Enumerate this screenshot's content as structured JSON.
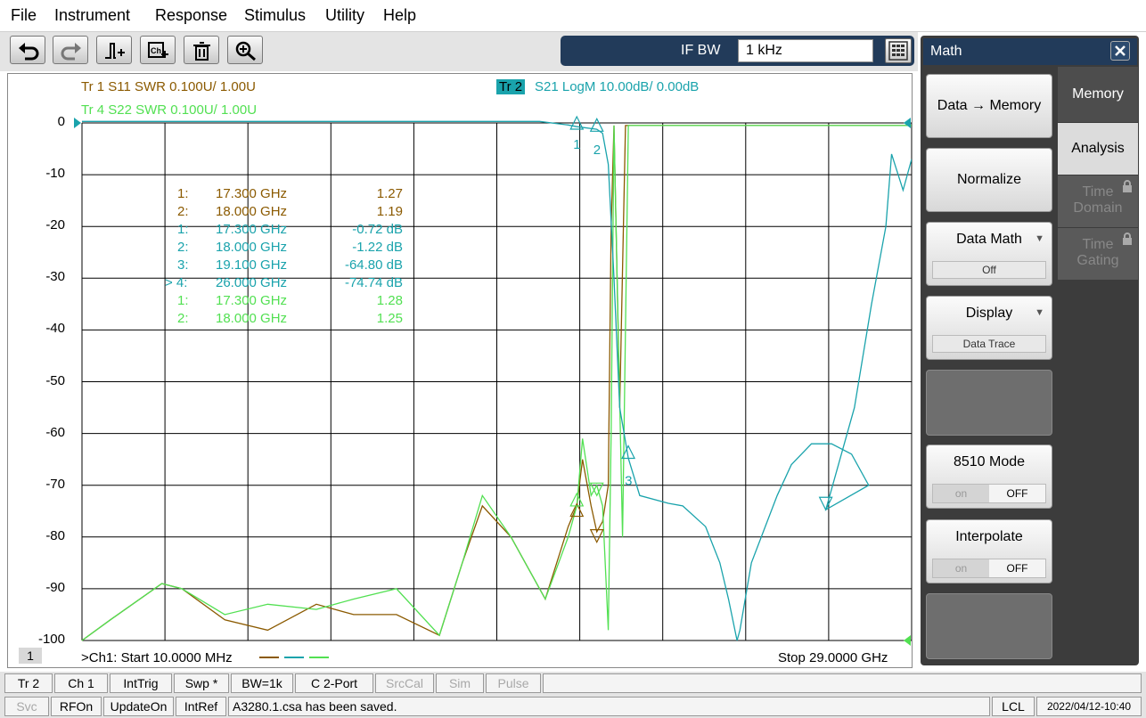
{
  "menu": [
    "File",
    "Instrument",
    "Response",
    "Stimulus",
    "Utility",
    "Help"
  ],
  "toolbar": {
    "undo_icon": "undo-arrow-icon",
    "redo_icon": "redo-arrow-icon",
    "marker_icon": "marker-add-icon",
    "channel_icon": "channel-add-icon",
    "delete_icon": "trash-icon",
    "zoom_icon": "zoom-in-icon"
  },
  "ifbw": {
    "label": "IF BW",
    "value": "1 kHz",
    "keypad_icon": "keypad-icon"
  },
  "traces": {
    "tr1": "Tr  1   S11 SWR 0.100U/  1.00U",
    "tr2_badge": "Tr  2",
    "tr2": "S21 LogM 10.00dB/  0.00dB",
    "tr4": "Tr  4   S22 SWR 0.100U/  1.00U"
  },
  "colors": {
    "tr1": "#8b5a00",
    "tr2": "#1aa3ac",
    "tr4": "#52e052",
    "grid": "#000000"
  },
  "chart_data": {
    "type": "line",
    "x_start": "10.0000 MHz",
    "x_stop": "29.0000 GHz",
    "xlim_ghz": [
      0.01,
      29
    ],
    "ylim": [
      -100,
      0
    ],
    "yticks": [
      "0",
      "-10",
      "-20",
      "-30",
      "-40",
      "-50",
      "-60",
      "-70",
      "-80",
      "-90",
      "-100"
    ],
    "grid": true,
    "series": [
      {
        "name": "S21 LogM",
        "points": [
          [
            0.01,
            0.3
          ],
          [
            8,
            0.3
          ],
          [
            14,
            0.3
          ],
          [
            16,
            0.3
          ],
          [
            17,
            -0.4
          ],
          [
            17.3,
            -0.72
          ],
          [
            18,
            -1.22
          ],
          [
            18.2,
            -2
          ],
          [
            18.4,
            -8
          ],
          [
            18.6,
            -30
          ],
          [
            18.8,
            -55
          ],
          [
            19.1,
            -64.8
          ],
          [
            19.5,
            -72
          ],
          [
            20.5,
            -73.5
          ],
          [
            21,
            -74
          ],
          [
            21.8,
            -78
          ],
          [
            22.3,
            -85
          ],
          [
            22.6,
            -92
          ],
          [
            22.9,
            -100
          ],
          [
            23,
            -98
          ],
          [
            23.4,
            -85
          ],
          [
            24.3,
            -72
          ],
          [
            24.8,
            -66
          ],
          [
            25.5,
            -62
          ],
          [
            26.2,
            -62
          ],
          [
            26.9,
            -64
          ],
          [
            27.5,
            -70
          ],
          [
            26,
            -74.74
          ],
          [
            27,
            -55
          ],
          [
            27.6,
            -35
          ],
          [
            28.1,
            -20
          ],
          [
            28.3,
            -6
          ],
          [
            28.7,
            -13
          ],
          [
            29,
            -7
          ]
        ]
      },
      {
        "name": "S11 SWR",
        "points": [
          [
            0.01,
            -100
          ],
          [
            1,
            -96
          ],
          [
            2.8,
            -89
          ],
          [
            3.5,
            -90
          ],
          [
            5,
            -96
          ],
          [
            6.5,
            -98
          ],
          [
            8.2,
            -93
          ],
          [
            9.5,
            -95
          ],
          [
            11,
            -95
          ],
          [
            12.5,
            -99
          ],
          [
            13.3,
            -85
          ],
          [
            14,
            -74
          ],
          [
            15,
            -80
          ],
          [
            16.2,
            -92
          ],
          [
            17,
            -78
          ],
          [
            17.3,
            -74
          ],
          [
            17.5,
            -65
          ],
          [
            17.8,
            -74
          ],
          [
            18,
            -79
          ],
          [
            18.2,
            -77
          ],
          [
            18.4,
            -70
          ],
          [
            18.5,
            -20
          ],
          [
            18.6,
            -0.5
          ],
          [
            18.8,
            -55
          ],
          [
            19,
            -0.5
          ],
          [
            29,
            -0.5
          ]
        ]
      },
      {
        "name": "S22 SWR",
        "points": [
          [
            0.01,
            -100
          ],
          [
            1,
            -96
          ],
          [
            2.8,
            -89
          ],
          [
            3.5,
            -90
          ],
          [
            5,
            -95
          ],
          [
            6.5,
            -93
          ],
          [
            8.2,
            -94
          ],
          [
            9.5,
            -92
          ],
          [
            11,
            -90
          ],
          [
            12.5,
            -99
          ],
          [
            13.3,
            -85
          ],
          [
            14,
            -72
          ],
          [
            15,
            -80
          ],
          [
            16.2,
            -92
          ],
          [
            17,
            -80
          ],
          [
            17.3,
            -74
          ],
          [
            17.5,
            -61
          ],
          [
            17.8,
            -72
          ],
          [
            18,
            -70
          ],
          [
            18.2,
            -74
          ],
          [
            18.4,
            -98
          ],
          [
            18.5,
            -60
          ],
          [
            18.6,
            -0.5
          ],
          [
            18.9,
            -80
          ],
          [
            19.1,
            -0.5
          ],
          [
            29,
            -0.5
          ]
        ]
      }
    ]
  },
  "markers": {
    "rows": [
      {
        "id": "1:",
        "freq": "17.300  GHz",
        "val": "1.27",
        "trace": "tr1"
      },
      {
        "id": "2:",
        "freq": "18.000  GHz",
        "val": "1.19",
        "trace": "tr1"
      },
      {
        "id": "1:",
        "freq": "17.300  GHz",
        "val": "-0.72 dB",
        "trace": "tr2"
      },
      {
        "id": "2:",
        "freq": "18.000  GHz",
        "val": "-1.22 dB",
        "trace": "tr2"
      },
      {
        "id": "3:",
        "freq": "19.100  GHz",
        "val": "-64.80 dB",
        "trace": "tr2"
      },
      {
        "id": "> 4:",
        "freq": "26.000  GHz",
        "val": "-74.74 dB",
        "trace": "tr2"
      },
      {
        "id": "1:",
        "freq": "17.300  GHz",
        "val": "1.28",
        "trace": "tr4"
      },
      {
        "id": "2:",
        "freq": "18.000  GHz",
        "val": "1.25",
        "trace": "tr4"
      }
    ],
    "labels": {
      "m1": "1",
      "m2": "2",
      "m3": "3"
    }
  },
  "channel": {
    "number": "1",
    "start_label": ">Ch1:  Start   10.0000 MHz",
    "stop_label": "Stop  29.0000 GHz"
  },
  "panel": {
    "title": "Math",
    "close_icon": "close-icon",
    "buttons": {
      "data_memory": "Data → Memory",
      "normalize": "Normalize",
      "data_math": "Data Math",
      "data_math_value": "Off",
      "display": "Display",
      "display_value": "Data Trace",
      "mode8510": "8510 Mode",
      "interpolate": "Interpolate",
      "on": "on",
      "off": "OFF"
    },
    "tabs": {
      "memory": "Memory",
      "analysis": "Analysis",
      "time_domain": "Time Domain",
      "time_gating": "Time Gating"
    }
  },
  "status_row1": [
    "Tr 2",
    "Ch 1",
    "IntTrig",
    "Swp *",
    "BW=1k",
    "C  2-Port",
    "SrcCal",
    "Sim",
    "Pulse"
  ],
  "status_row2": {
    "svc": "Svc",
    "rfon": "RFOn",
    "updateon": "UpdateOn",
    "intref": "IntRef",
    "message": "A3280.1.csa has been saved.",
    "lcl": "LCL",
    "datetime": "2022/04/12-10:40"
  }
}
